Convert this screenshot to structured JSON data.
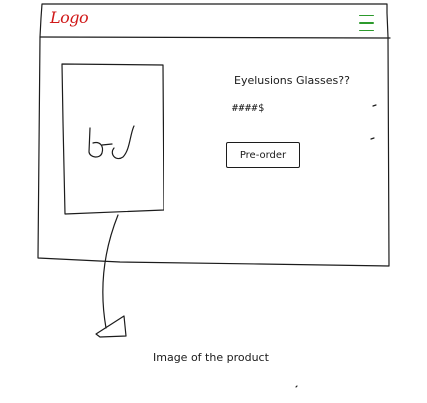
{
  "header": {
    "logo_text": "Logo",
    "menu_icon": "hamburger-menu-icon"
  },
  "product": {
    "image_icon": "glasses-sketch-icon",
    "title": "Eyelusions Glasses??",
    "price": "####$",
    "preorder_label": "Pre-order"
  },
  "annotation": {
    "text": "Image of the product"
  },
  "colors": {
    "logo": "#d01818",
    "menu_icon": "#2c9a2c",
    "ink": "#1c1c1c"
  }
}
